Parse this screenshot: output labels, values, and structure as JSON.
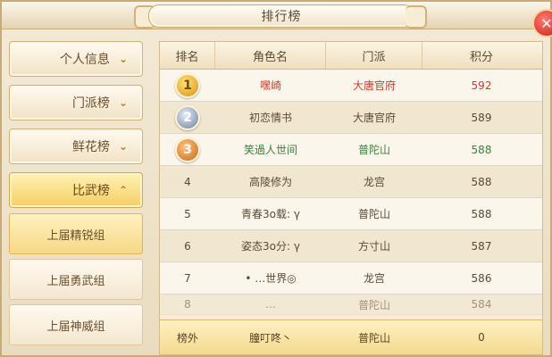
{
  "window": {
    "title": "排行榜",
    "close_symbol": "✕"
  },
  "sidebar": {
    "items": [
      {
        "label": "个人信息",
        "chevron": "⌄"
      },
      {
        "label": "门派榜",
        "chevron": "⌄"
      },
      {
        "label": "鲜花榜",
        "chevron": "⌄"
      },
      {
        "label": "比武榜",
        "chevron": "⌃"
      }
    ],
    "subitems": [
      {
        "label": "上届精锐组"
      },
      {
        "label": "上届勇武组"
      },
      {
        "label": "上届神威组"
      }
    ]
  },
  "table": {
    "headers": [
      "排名",
      "角色名",
      "门派",
      "积分"
    ],
    "rows": [
      {
        "rank": "1",
        "name": "嘿崎",
        "school": "大唐官府",
        "score": "592"
      },
      {
        "rank": "2",
        "name": "初恋情书",
        "school": "大唐官府",
        "score": "589"
      },
      {
        "rank": "3",
        "name": "笑過人世间",
        "school": "普陀山",
        "score": "588"
      },
      {
        "rank": "4",
        "name": "高陵修为",
        "school": "龙宫",
        "score": "588"
      },
      {
        "rank": "5",
        "name": "青春3o载: γ",
        "school": "普陀山",
        "score": "588"
      },
      {
        "rank": "6",
        "name": "姿态3o分: γ",
        "school": "方寸山",
        "score": "587"
      },
      {
        "rank": "7",
        "name": "• …世界◎",
        "school": "龙宫",
        "score": "586"
      },
      {
        "rank": "8",
        "name": "…",
        "school": "普陀山",
        "score": "584"
      }
    ],
    "footer": {
      "rank": "榜外",
      "name": "朣叮咚丶",
      "school": "普陀山",
      "score": "0"
    }
  },
  "colors": {
    "rank1": "#cc3c2c",
    "rank3": "#3e7f3e",
    "active_tab": "#f4cf62"
  }
}
